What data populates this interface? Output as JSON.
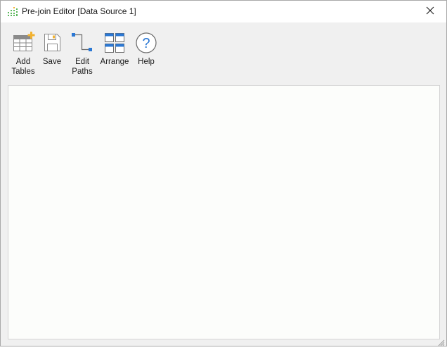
{
  "window": {
    "title": "Pre-join Editor [Data Source 1]",
    "app_icon": "bar-chart-app-icon",
    "close_icon": "close-icon"
  },
  "toolbar": {
    "add_tables_label": "Add\nTables",
    "save_label": "Save",
    "edit_paths_label": "Edit\nPaths",
    "arrange_label": "Arrange",
    "help_label": "Help",
    "icons": {
      "add_tables": "add-table-icon",
      "save": "save-icon",
      "edit_paths": "edit-paths-icon",
      "arrange": "arrange-icon",
      "help": "help-icon"
    }
  },
  "colors": {
    "accent_blue": "#2b78d4",
    "add_plus": "#f2b230",
    "app_green": "#5bb85c"
  }
}
